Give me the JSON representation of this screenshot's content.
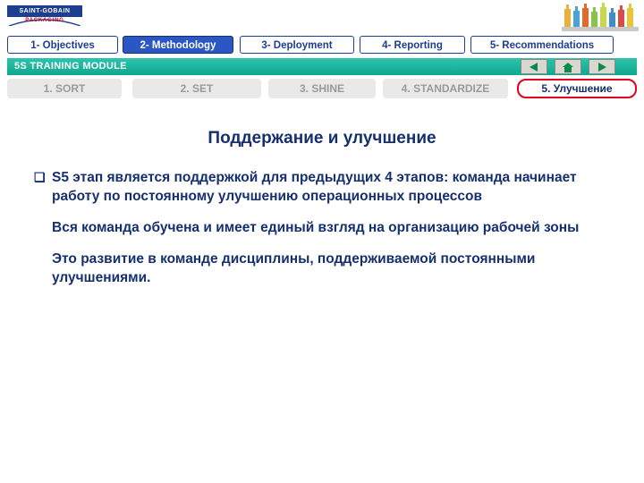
{
  "logo": {
    "brand": "SAINT-GOBAIN",
    "division": "PACKAGING"
  },
  "nav_tabs": [
    {
      "label": "1- Objectives",
      "active": false
    },
    {
      "label": "2- Methodology",
      "active": true
    },
    {
      "label": "3- Deployment",
      "active": false
    },
    {
      "label": "4- Reporting",
      "active": false
    },
    {
      "label": "5- Recommendations",
      "active": false
    }
  ],
  "module_band": {
    "title": "5S TRAINING MODULE",
    "back_icon": "previous-triangle-icon",
    "home_icon": "home-icon",
    "forward_icon": "next-triangle-icon"
  },
  "steps": [
    {
      "label": "1. SORT",
      "current": false
    },
    {
      "label": "2. SET",
      "current": false
    },
    {
      "label": "3. SHINE",
      "current": false
    },
    {
      "label": "4. STANDARDIZE",
      "current": false
    },
    {
      "label": "5. Улучшение",
      "current": true
    }
  ],
  "slide": {
    "title": "Поддержание и улучшение",
    "bullets": [
      {
        "marker": "❑",
        "text": "S5 этап является поддержкой для предыдущих 4 этапов: команда начинает работу по постоянному улучшению операционных процессов"
      },
      {
        "marker": "",
        "text": "Вся команда обучена и имеет единый взгляд на организацию рабочей зоны"
      },
      {
        "marker": "",
        "text": "Это развитие в команде дисциплины, поддерживаемой постоянными улучшениями."
      }
    ]
  },
  "colors": {
    "brand_blue": "#16306f",
    "tab_active": "#2b57c4",
    "band_green": "#1ab6a0",
    "accent_red": "#e2001a"
  }
}
